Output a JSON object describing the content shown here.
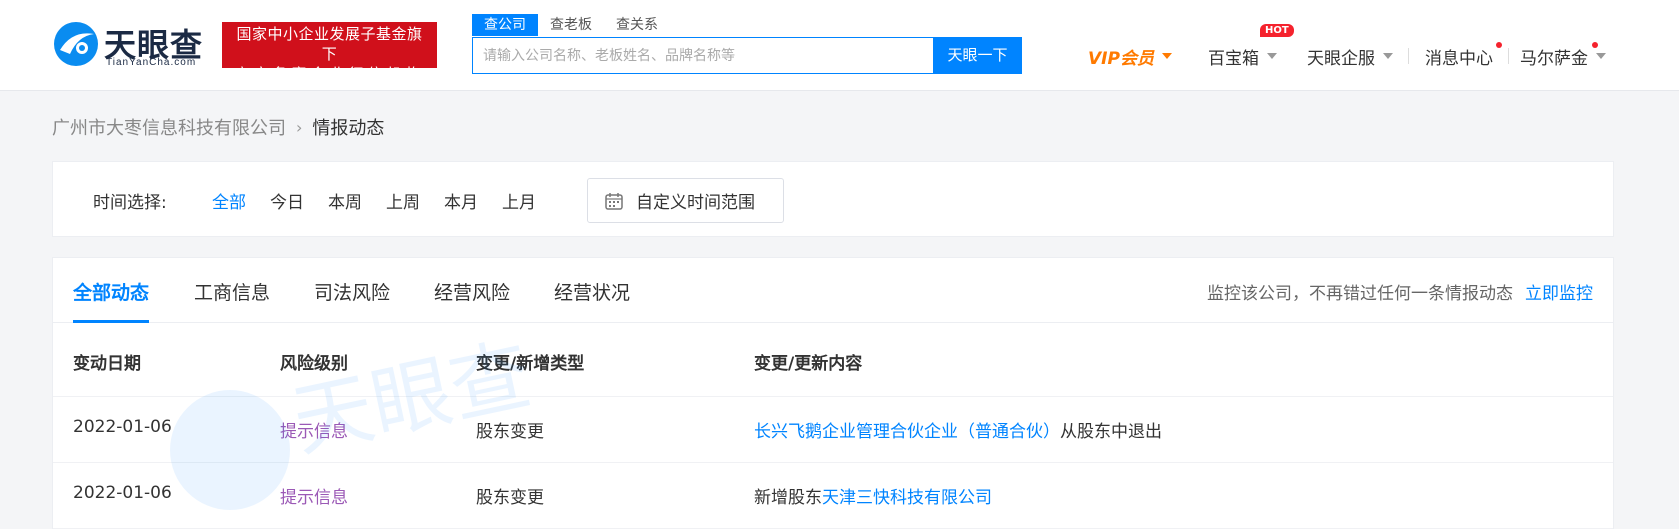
{
  "header": {
    "logo": {
      "brand": "天眼查",
      "domain": "TianYanCha.com"
    },
    "gov_badge": {
      "line1": "国家中小企业发展子基金旗下",
      "line2": "官方备案企业征信机构"
    },
    "search": {
      "tabs": [
        "查公司",
        "查老板",
        "查关系"
      ],
      "placeholder": "请输入公司名称、老板姓名、品牌名称等",
      "button": "天眼一下"
    },
    "nav": {
      "vip": "VIP会员",
      "baibao": "百宝箱",
      "hot": "HOT",
      "qifu": "天眼企服",
      "messages": "消息中心",
      "user": "马尔萨金"
    }
  },
  "breadcrumb": {
    "company": "广州市大枣信息科技有限公司",
    "current": "情报动态"
  },
  "time_filter": {
    "label": "时间选择:",
    "options": [
      "全部",
      "今日",
      "本周",
      "上周",
      "本月",
      "上月"
    ],
    "custom": "自定义时间范围"
  },
  "tabs": [
    "全部动态",
    "工商信息",
    "司法风险",
    "经营风险",
    "经营状况"
  ],
  "monitor": {
    "text": "监控该公司，不再错过任何一条情报动态",
    "link": "立即监控"
  },
  "table": {
    "headers": [
      "变动日期",
      "风险级别",
      "变更/新增类型",
      "变更/更新内容"
    ],
    "rows": [
      {
        "date": "2022-01-06",
        "risk": "提示信息",
        "type": "股东变更",
        "content_prefix": "",
        "content_link": "长兴飞鹅企业管理合伙企业（普通合伙）",
        "content_suffix": "从股东中退出"
      },
      {
        "date": "2022-01-06",
        "risk": "提示信息",
        "type": "股东变更",
        "content_prefix": "新增股东",
        "content_link": "天津三快科技有限公司",
        "content_suffix": ""
      }
    ]
  },
  "colors": {
    "primary": "#0084ff",
    "vip": "#ff7a00",
    "badge_red": "#d0101b",
    "risk_purple": "#9b59b6"
  }
}
